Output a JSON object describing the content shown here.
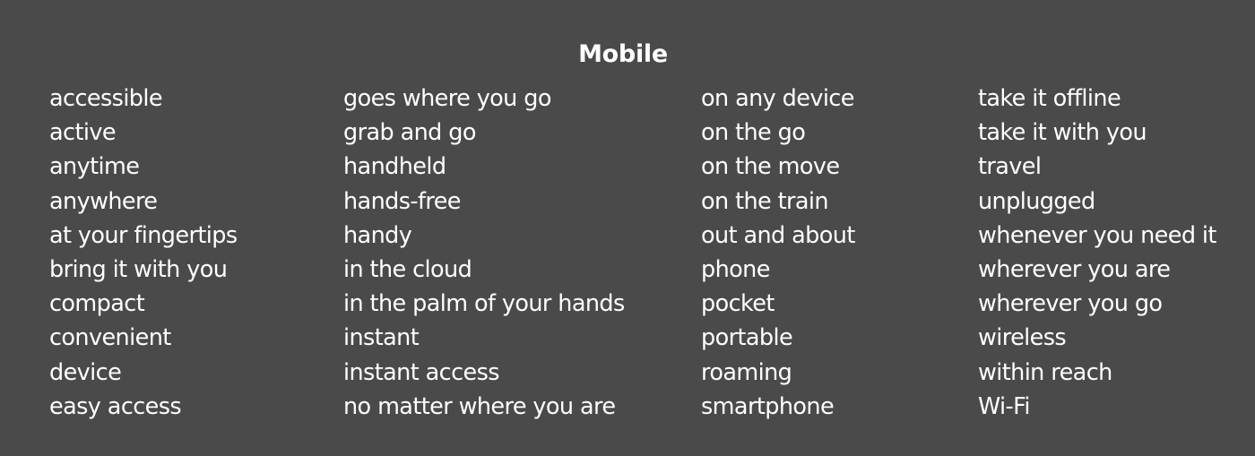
{
  "title": "Mobile",
  "colors": {
    "background": "#4a4a4a",
    "text": "#ffffff"
  },
  "columns": [
    {
      "items": [
        "accessible",
        "active",
        "anytime",
        "anywhere",
        "at your fingertips",
        "bring it with you",
        "compact",
        "convenient",
        "device",
        "easy access"
      ]
    },
    {
      "items": [
        "goes where you go",
        "grab and go",
        "handheld",
        "hands-free",
        "handy",
        "in the cloud",
        "in the palm of your hands",
        "instant",
        "instant access",
        "no matter where you are"
      ]
    },
    {
      "items": [
        "on any device",
        "on the go",
        "on the move",
        "on the train",
        "out and about",
        "phone",
        "pocket",
        "portable",
        "roaming",
        "smartphone"
      ]
    },
    {
      "items": [
        "take it offline",
        "take it with you",
        "travel",
        "unplugged",
        "whenever you need it",
        "wherever you are",
        "wherever you go",
        "wireless",
        "within reach",
        "Wi-Fi"
      ]
    }
  ]
}
